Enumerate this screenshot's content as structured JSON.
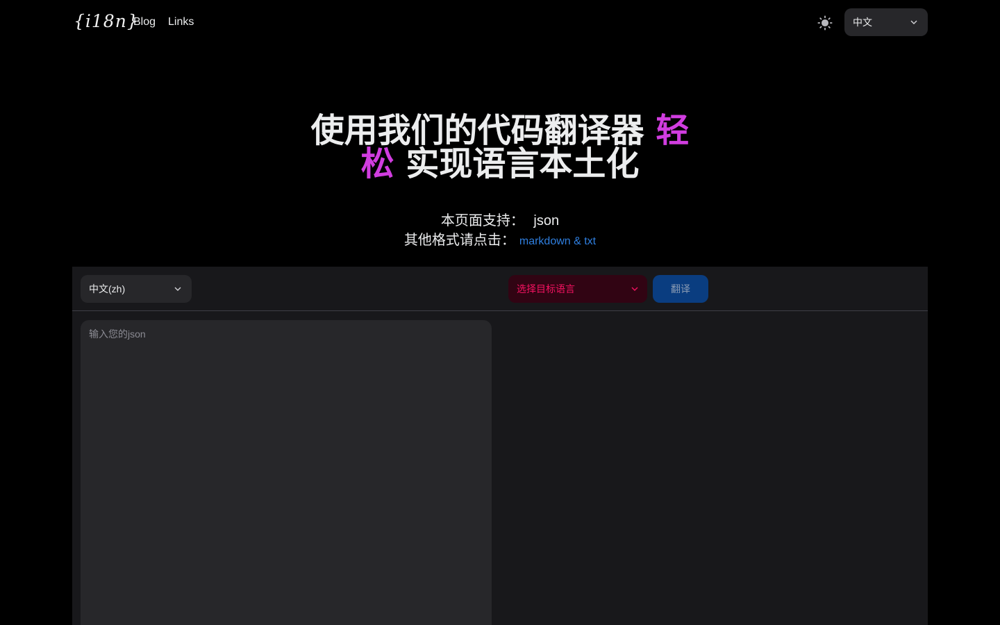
{
  "header": {
    "logo": "{i18n}",
    "nav": [
      {
        "label": "Blog"
      },
      {
        "label": "Links"
      }
    ],
    "theme_icon": "sun-icon",
    "language": "中文"
  },
  "hero": {
    "title_part1": "使用我们的代码翻译器 ",
    "title_accent": "轻松",
    "title_part2": " 实现语言本土化"
  },
  "support": {
    "label": "本页面支持：",
    "format": "json",
    "other_label": "其他格式请点击：",
    "other_link": "markdown & txt"
  },
  "editor": {
    "source_language": "中文(zh)",
    "target_placeholder": "选择目标语言",
    "translate_label": "翻译",
    "input_placeholder": "输入您的json"
  },
  "colors": {
    "accent": "#d13de0",
    "link": "#2f7fe0",
    "danger": "#f31260",
    "primary": "#0a3d80"
  }
}
